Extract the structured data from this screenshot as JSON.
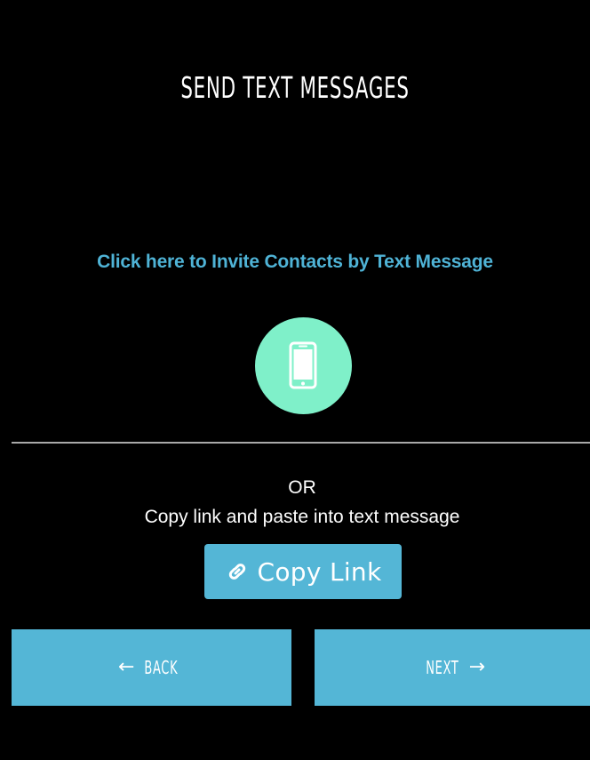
{
  "header": {
    "title": "SEND TEXT MESSAGES"
  },
  "invite": {
    "link_text": "Click here to Invite Contacts by Text Message",
    "icon": "mobile-phone-icon"
  },
  "alternative": {
    "or_text": "OR",
    "instructions": "Copy link and paste into text message"
  },
  "copy_link": {
    "icon": "link-icon",
    "label": "Copy Link"
  },
  "navigation": {
    "back_label": "BACK",
    "back_arrow": "←",
    "next_label": "NEXT",
    "next_arrow": "→"
  },
  "colors": {
    "background": "#000000",
    "accent_blue": "#54b6d6",
    "link_blue": "#4fb3d6",
    "phone_circle": "#7ff0c9",
    "text": "#ffffff",
    "divider": "#a9a9a9"
  }
}
